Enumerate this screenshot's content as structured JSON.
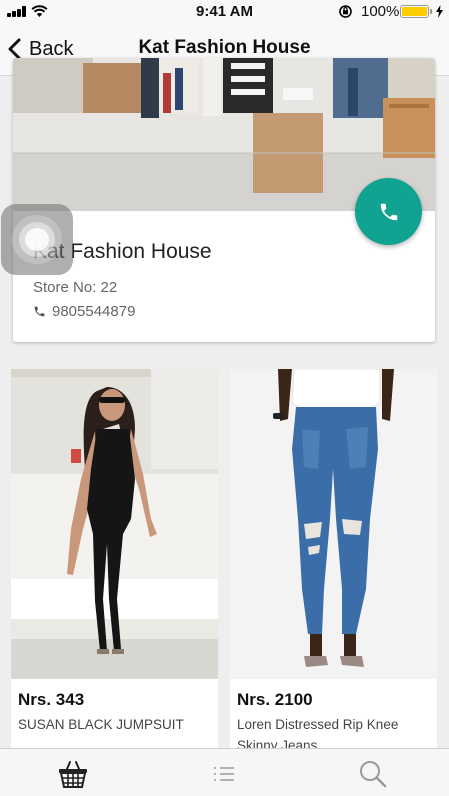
{
  "status_bar": {
    "time": "9:41 AM",
    "battery_percent": "100%",
    "battery_level": 1.0
  },
  "nav": {
    "back_label": "Back",
    "title": "Kat Fashion House"
  },
  "store": {
    "name": "Kat Fashion House",
    "store_no": "Store No: 22",
    "phone": "9805544879",
    "call_button_color": "#10a391"
  },
  "products": [
    {
      "price": "Nrs. 343",
      "name": "SUSAN BLACK JUMPSUIT"
    },
    {
      "price": "Nrs. 2100",
      "name": "Loren Distressed Rip Knee Skinny Jeans"
    }
  ],
  "tabs": [
    {
      "icon": "basket-icon",
      "active": true
    },
    {
      "icon": "list-icon",
      "active": false
    },
    {
      "icon": "search-icon",
      "active": false
    }
  ]
}
